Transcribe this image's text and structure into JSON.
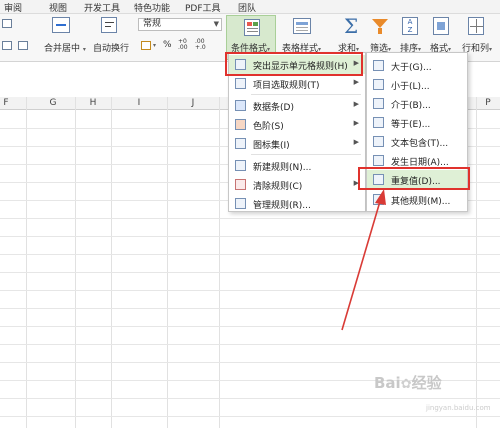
{
  "menu_tabs": [
    "审阅",
    "视图",
    "开发工具",
    "特色功能",
    "PDF工具",
    "团队"
  ],
  "ribbon": {
    "merge_center": "合并居中",
    "wrap_text": "自动换行",
    "number_format": "常规",
    "percent": "%",
    "decimal_add": ".00\n+.0",
    "conditional_format": "条件格式",
    "table_style": "表格样式",
    "sum": "求和",
    "filter": "筛选",
    "sort": "排序",
    "format": "格式",
    "row_col": "行和列"
  },
  "columns": [
    "F",
    "G",
    "H",
    "I",
    "J",
    "P"
  ],
  "cf_menu": {
    "items": [
      {
        "label": "突出显示单元格规则(H)",
        "icon": "highlight-rules-icon",
        "submenu": true
      },
      {
        "label": "项目选取规则(T)",
        "icon": "top-bottom-rules-icon",
        "submenu": true
      },
      {
        "label": "数据条(D)",
        "icon": "data-bars-icon",
        "submenu": true
      },
      {
        "label": "色阶(S)",
        "icon": "color-scales-icon",
        "submenu": true
      },
      {
        "label": "图标集(I)",
        "icon": "icon-sets-icon",
        "submenu": true
      },
      {
        "label": "新建规则(N)...",
        "icon": "new-rule-icon",
        "submenu": false
      },
      {
        "label": "清除规则(C)",
        "icon": "clear-rules-icon",
        "submenu": true
      },
      {
        "label": "管理规则(R)...",
        "icon": "manage-rules-icon",
        "submenu": false
      }
    ]
  },
  "sub_menu": {
    "items": [
      {
        "label": "大于(G)...",
        "icon": "greater-than-icon"
      },
      {
        "label": "小于(L)...",
        "icon": "less-than-icon"
      },
      {
        "label": "介于(B)...",
        "icon": "between-icon"
      },
      {
        "label": "等于(E)...",
        "icon": "equal-to-icon"
      },
      {
        "label": "文本包含(T)...",
        "icon": "text-contains-icon"
      },
      {
        "label": "发生日期(A)...",
        "icon": "date-occurring-icon"
      },
      {
        "label": "重复值(D)...",
        "icon": "duplicate-values-icon"
      },
      {
        "label": "其他规则(M)...",
        "icon": "more-rules-icon"
      }
    ]
  },
  "watermark": {
    "text": "Bai",
    "text2": "经验",
    "sub": "jingyan.baidu.com"
  },
  "colors": {
    "accent_green": "#dff0d6",
    "highlight_red": "#e0322d",
    "arrow_red": "#d93b36"
  }
}
